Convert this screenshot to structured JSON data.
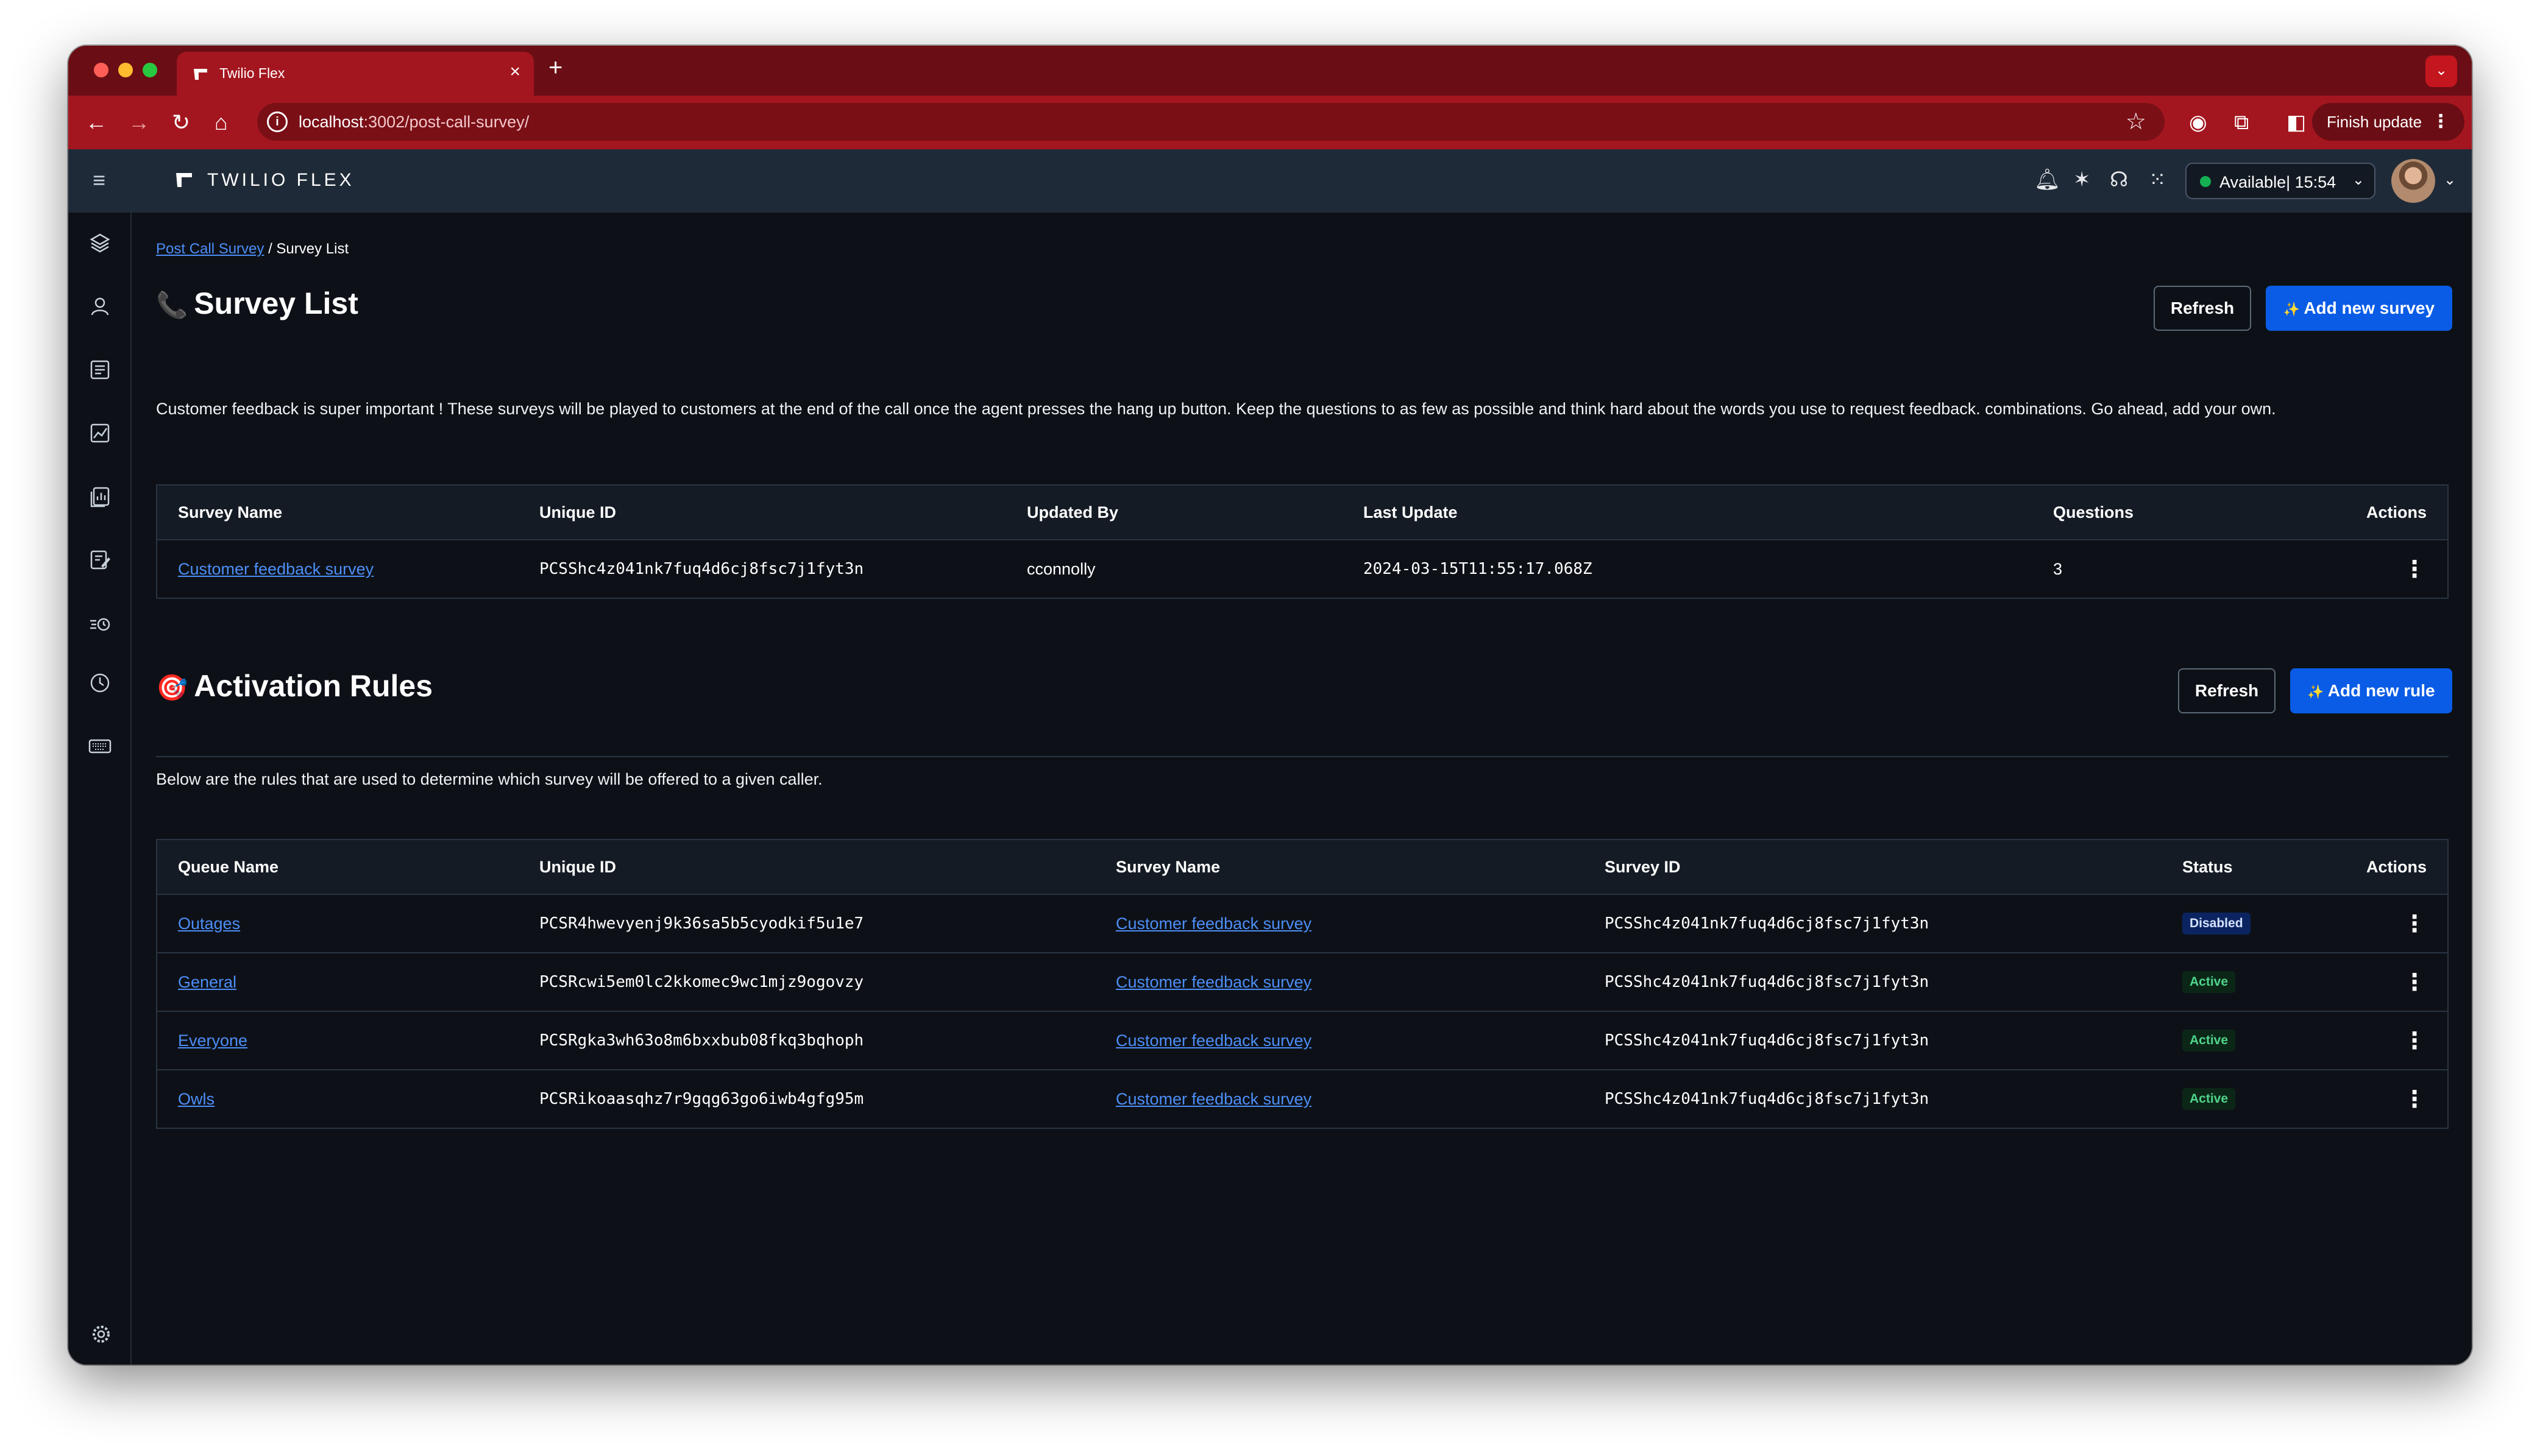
{
  "browser": {
    "tab_title": "Twilio Flex",
    "url_host": "localhost",
    "url_path": ":3002/post-call-survey/",
    "finish_update": "Finish update"
  },
  "topbar": {
    "brand": "TWILIO FLEX",
    "status": "Available| 15:54"
  },
  "breadcrumb": {
    "parent": "Post Call Survey",
    "separator": "/",
    "current": "Survey List"
  },
  "survey_section": {
    "emoji": "📞",
    "title": "Survey List",
    "refresh": "Refresh",
    "add": "Add new survey",
    "description": "Customer feedback is super important ! These surveys will be played to customers at the end of the call once the agent presses the hang up button. Keep the questions to as few as possible and think hard about the words you use to request feedback. combinations. Go ahead, add your own.",
    "columns": [
      "Survey Name",
      "Unique ID",
      "Updated By",
      "Last Update",
      "Questions",
      "Actions"
    ],
    "rows": [
      {
        "name": "Customer feedback survey",
        "unique_id": "PCSShc4z041nk7fuq4d6cj8fsc7j1fyt3n",
        "updated_by": "cconnolly",
        "last_update": "2024-03-15T11:55:17.068Z",
        "questions": "3"
      }
    ]
  },
  "rules_section": {
    "emoji": "🎯",
    "title": "Activation Rules",
    "refresh": "Refresh",
    "add": "Add new rule",
    "description": "Below are the rules that are used to determine which survey will be offered to a given caller.",
    "columns": [
      "Queue Name",
      "Unique ID",
      "Survey Name",
      "Survey ID",
      "Status",
      "Actions"
    ],
    "rows": [
      {
        "queue": "Outages",
        "unique_id": "PCSR4hwevyenj9k36sa5b5cyodkif5u1e7",
        "survey_name": "Customer feedback survey",
        "survey_id": "PCSShc4z041nk7fuq4d6cj8fsc7j1fyt3n",
        "status": "Disabled"
      },
      {
        "queue": "General",
        "unique_id": "PCSRcwi5em0lc2kkomec9wc1mjz9ogovzy",
        "survey_name": "Customer feedback survey",
        "survey_id": "PCSShc4z041nk7fuq4d6cj8fsc7j1fyt3n",
        "status": "Active"
      },
      {
        "queue": "Everyone",
        "unique_id": "PCSRgka3wh63o8m6bxxbub08fkq3bqhoph",
        "survey_name": "Customer feedback survey",
        "survey_id": "PCSShc4z041nk7fuq4d6cj8fsc7j1fyt3n",
        "status": "Active"
      },
      {
        "queue": "Owls",
        "unique_id": "PCSRikoaasqhz7r9gqg63go6iwb4gfg95m",
        "survey_name": "Customer feedback survey",
        "survey_id": "PCSShc4z041nk7fuq4d6cj8fsc7j1fyt3n",
        "status": "Active"
      }
    ]
  },
  "colors": {
    "browser_chrome": "#a4161f",
    "primary_button": "#0a5ce6",
    "link": "#4d8ef7",
    "status_available": "#14b053"
  }
}
